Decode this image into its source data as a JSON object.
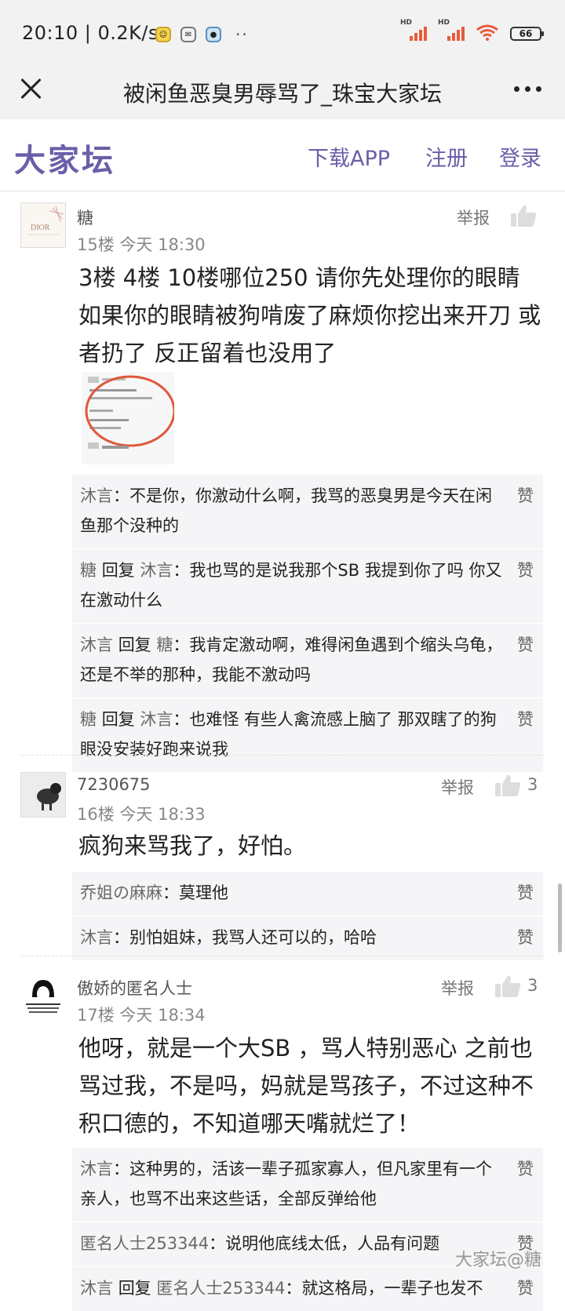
{
  "status_bar": {
    "time": "20:10",
    "speed": "0.2K/s",
    "battery": "66",
    "hd": "HD"
  },
  "title_bar": {
    "title": "被闲鱼恶臭男辱骂了_珠宝大家坛"
  },
  "site_header": {
    "logo": "大家坛",
    "download": "下载APP",
    "register": "注册",
    "login": "登录"
  },
  "posts": [
    {
      "author": "糖",
      "floor": "15楼",
      "time": "今天 18:30",
      "report": "举报",
      "likes": "",
      "avatar_text": "DIOR",
      "content": "3楼 4楼 10楼哪位250 请你先处理你的眼睛 如果你的眼睛被狗啃废了麻烦你挖出来开刀 或者扔了 反正留着也没用了",
      "replies": [
        {
          "from": "沐言",
          "to": "",
          "text": "不是你，你激动什么啊，我骂的恶臭男是今天在闲鱼那个没种的",
          "like": "赞"
        },
        {
          "from": "糖",
          "to": "沐言",
          "text": "我也骂的是说我那个SB 我提到你了吗 你又在激动什么",
          "like": "赞"
        },
        {
          "from": "沐言",
          "to": "糖",
          "text": "我肯定激动啊，难得闲鱼遇到个缩头乌龟，还是不举的那种，我能不激动吗",
          "like": "赞"
        },
        {
          "from": "糖",
          "to": "沐言",
          "text": "也难怪 有些人禽流感上脑了 那双瞎了的狗眼没安装好跑来说我",
          "like": "赞"
        }
      ]
    },
    {
      "author": "7230675",
      "floor": "16楼",
      "time": "今天 18:33",
      "report": "举报",
      "likes": "3",
      "content": "疯狗来骂我了，好怕。",
      "replies": [
        {
          "from": "乔姐の麻麻",
          "to": "",
          "text": "莫理他",
          "like": "赞"
        },
        {
          "from": "沐言",
          "to": "",
          "text": "别怕姐妹，我骂人还可以的，哈哈",
          "like": "赞"
        }
      ]
    },
    {
      "author": "傲娇的匿名人士",
      "floor": "17楼",
      "time": "今天 18:34",
      "report": "举报",
      "likes": "3",
      "content": "他呀，就是一个大SB ，骂人特别恶心 之前也骂过我，不是吗，妈就是骂孩子，不过这种不积口德的，不知道哪天嘴就烂了！",
      "replies": [
        {
          "from": "沐言",
          "to": "",
          "text": "这种男的，活该一辈子孤家寡人，但凡家里有一个亲人，也骂不出来这些话，全部反弹给他",
          "like": "赞"
        },
        {
          "from": "匿名人士253344",
          "to": "",
          "text": "说明他底线太低，人品有问题",
          "like": "赞"
        },
        {
          "from": "沐言",
          "to": "匿名人士253344",
          "text": "就这格局，一辈子也发不",
          "like": "赞"
        }
      ]
    }
  ],
  "labels": {
    "reply_word": "回复",
    "colon": "："
  },
  "watermark": "大家坛@糖",
  "colors": {
    "brand": "#6b5ea8",
    "reply_bg": "#f5f5f7"
  }
}
